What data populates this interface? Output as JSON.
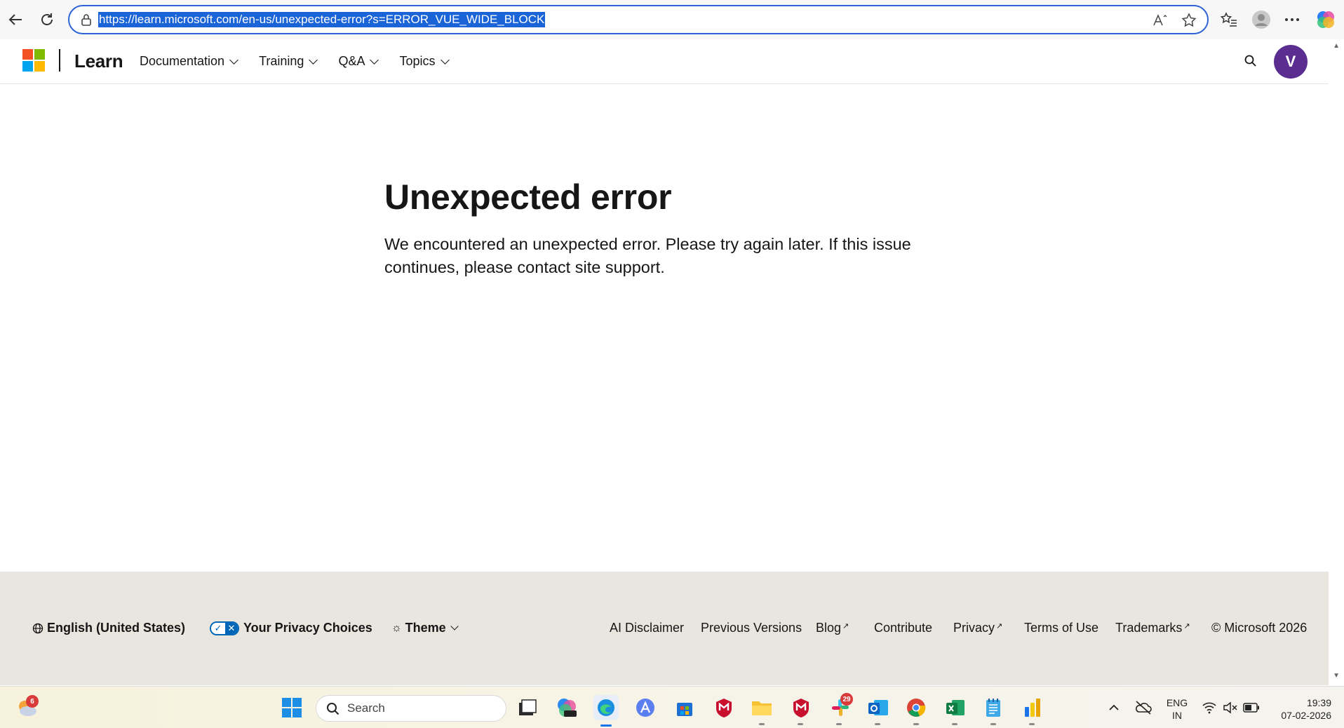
{
  "browser": {
    "url": "https://learn.microsoft.com/en-us/unexpected-error?s=ERROR_VUE_WIDE_BLOCK",
    "icons": [
      "back-arrow-icon",
      "refresh-icon",
      "lock-icon",
      "read-aloud-icon",
      "favorite-star-icon",
      "favorites-list-icon",
      "profile-icon",
      "more-icon",
      "copilot-icon"
    ]
  },
  "header": {
    "brand": "Learn",
    "menu": [
      {
        "label": "Documentation"
      },
      {
        "label": "Training"
      },
      {
        "label": "Q&A"
      },
      {
        "label": "Topics"
      }
    ],
    "avatar_initial": "V"
  },
  "main": {
    "title": "Unexpected error",
    "message": "We encountered an unexpected error. Please try again later. If this issue continues, please contact site support."
  },
  "footer": {
    "language": "English (United States)",
    "privacy_choices": "Your Privacy Choices",
    "theme": "Theme",
    "links": {
      "ai_disclaimer": "AI Disclaimer",
      "previous_versions": "Previous Versions",
      "blog": "Blog",
      "contribute": "Contribute",
      "privacy": "Privacy",
      "terms": "Terms of Use",
      "trademarks": "Trademarks",
      "copyright": "© Microsoft 2026"
    }
  },
  "taskbar": {
    "weather_badge": "6",
    "search_placeholder": "Search",
    "slack_badge": "29",
    "lang_line1": "ENG",
    "lang_line2": "IN",
    "time": "19:39",
    "date": "07-02-2026"
  },
  "colors": {
    "address_border": "#2f64d6",
    "url_highlight": "#1a64d8",
    "avatar": "#5c2d91",
    "footer_bg": "#e8e6df",
    "ms_red": "#f25022",
    "ms_green": "#7fba00",
    "ms_blue": "#00a4ef",
    "ms_yellow": "#ffb900"
  }
}
